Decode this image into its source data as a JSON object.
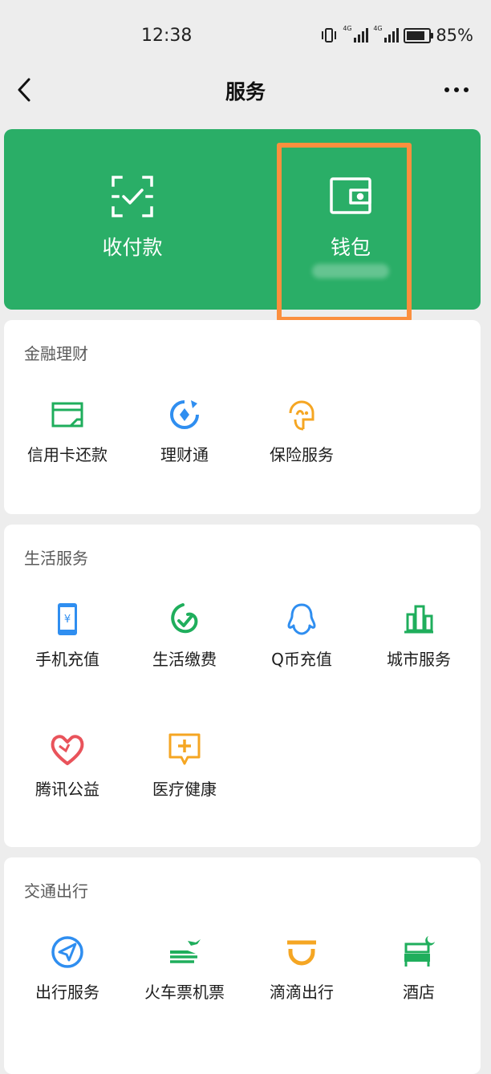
{
  "status_bar": {
    "time": "12:38",
    "battery": "85%",
    "battery_level": 0.85
  },
  "nav": {
    "title": "服务"
  },
  "wallet_card": {
    "items": [
      {
        "label": "收付款",
        "icon": "scan-frame-icon"
      },
      {
        "label": "钱包",
        "icon": "wallet-icon"
      }
    ]
  },
  "sections": [
    {
      "title": "金融理财",
      "items": [
        {
          "label": "信用卡还款",
          "icon": "credit-card-icon"
        },
        {
          "label": "理财通",
          "icon": "wealth-icon"
        },
        {
          "label": "保险服务",
          "icon": "insurance-icon"
        }
      ]
    },
    {
      "title": "生活服务",
      "items": [
        {
          "label": "手机充值",
          "icon": "phone-recharge-icon"
        },
        {
          "label": "生活缴费",
          "icon": "utility-payment-icon"
        },
        {
          "label": "Q币充值",
          "icon": "qq-penguin-icon"
        },
        {
          "label": "城市服务",
          "icon": "city-buildings-icon"
        },
        {
          "label": "腾讯公益",
          "icon": "charity-heart-icon"
        },
        {
          "label": "医疗健康",
          "icon": "medical-plus-icon"
        }
      ]
    },
    {
      "title": "交通出行",
      "items": [
        {
          "label": "出行服务",
          "icon": "navigation-arrow-icon"
        },
        {
          "label": "火车票机票",
          "icon": "train-plane-icon"
        },
        {
          "label": "滴滴出行",
          "icon": "didi-icon"
        },
        {
          "label": "酒店",
          "icon": "hotel-bed-icon"
        }
      ]
    }
  ],
  "colors": {
    "wechat_green": "#2aae67",
    "highlight_orange": "#fb8f3e",
    "icon_green": "#1fae5c",
    "icon_blue": "#2f8ef0",
    "icon_orange": "#f5a623",
    "icon_red": "#e9535b"
  }
}
